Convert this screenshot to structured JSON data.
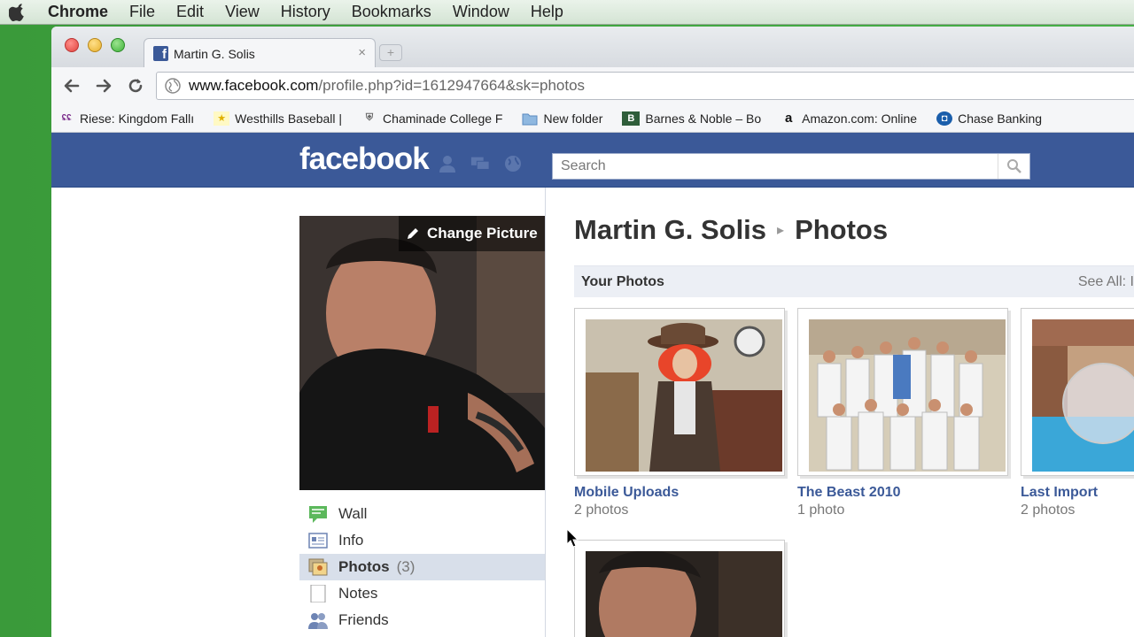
{
  "menubar": {
    "app": "Chrome",
    "items": [
      "File",
      "Edit",
      "View",
      "History",
      "Bookmarks",
      "Window",
      "Help"
    ]
  },
  "browser": {
    "tab_title": "Martin G. Solis",
    "tab_close": "×",
    "new_tab": "+",
    "url_host": "www.facebook.com",
    "url_path": "/profile.php?id=1612947664&sk=photos",
    "bookmarks": [
      {
        "label": "Riese: Kingdom Fallı",
        "icon": "riese-icon"
      },
      {
        "label": "Westhills Baseball |",
        "icon": "star-icon"
      },
      {
        "label": "Chaminade College F",
        "icon": "shield-icon"
      },
      {
        "label": "New folder",
        "icon": "folder-icon"
      },
      {
        "label": "Barnes & Noble – Bo",
        "icon": "bn-icon"
      },
      {
        "label": "Amazon.com: Online",
        "icon": "amazon-icon"
      },
      {
        "label": "Chase Banking",
        "icon": "chase-icon"
      }
    ]
  },
  "facebook": {
    "logo": "facebook",
    "search_placeholder": "Search",
    "change_picture": "Change Picture",
    "nav": [
      {
        "label": "Wall",
        "count": "",
        "icon": "wall-icon"
      },
      {
        "label": "Info",
        "count": "",
        "icon": "info-icon"
      },
      {
        "label": "Photos",
        "count": "(3)",
        "icon": "photos-icon"
      },
      {
        "label": "Notes",
        "count": "",
        "icon": "notes-icon"
      },
      {
        "label": "Friends",
        "count": "",
        "icon": "friends-icon"
      }
    ],
    "page_owner": "Martin G. Solis",
    "page_section": "Photos",
    "breadcrumb_sep": "▸",
    "section_title": "Your Photos",
    "see_all": "See All: I",
    "albums": [
      {
        "name": "Mobile Uploads",
        "count": "2 photos"
      },
      {
        "name": "The Beast 2010",
        "count": "1 photo"
      },
      {
        "name": "Last Import",
        "count": "2 photos"
      }
    ]
  },
  "colors": {
    "fb_blue": "#3b5998",
    "nav_selected": "#d8dfea"
  }
}
